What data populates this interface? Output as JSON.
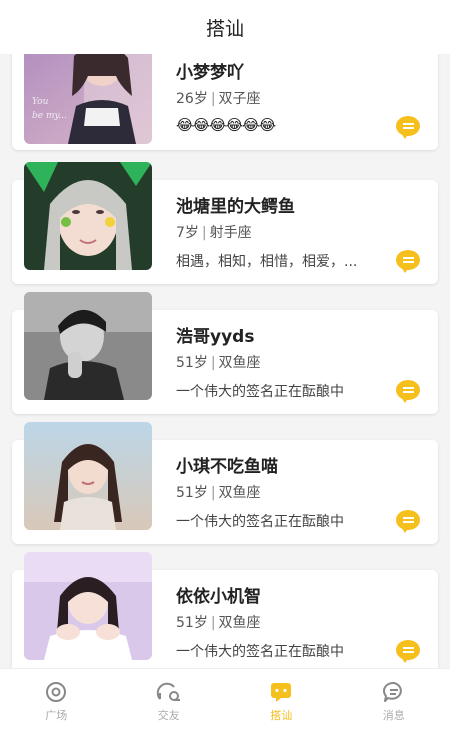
{
  "header": {
    "title": "搭讪"
  },
  "users": [
    {
      "name": "小梦梦吖",
      "age": "26岁",
      "sign": "双子座",
      "signature": "😂😂😂😂😂😂"
    },
    {
      "name": "池塘里的大鳄鱼",
      "age": "7岁",
      "sign": "射手座",
      "signature": "相遇，相知，相惜，相爱，..."
    },
    {
      "name": "浩哥yyds",
      "age": "51岁",
      "sign": "双鱼座",
      "signature": "一个伟大的签名正在酝酿中"
    },
    {
      "name": "小琪不吃鱼喵",
      "age": "51岁",
      "sign": "双鱼座",
      "signature": "一个伟大的签名正在酝酿中"
    },
    {
      "name": "依依小机智",
      "age": "51岁",
      "sign": "双鱼座",
      "signature": "一个伟大的签名正在酝酿中"
    }
  ],
  "tabs": [
    {
      "label": "广场",
      "icon": "plaza-icon"
    },
    {
      "label": "交友",
      "icon": "friends-icon"
    },
    {
      "label": "搭讪",
      "icon": "chat-icon"
    },
    {
      "label": "消息",
      "icon": "message-icon"
    }
  ],
  "colors": {
    "accent": "#f5bf1c",
    "background": "#f4f4f4"
  }
}
